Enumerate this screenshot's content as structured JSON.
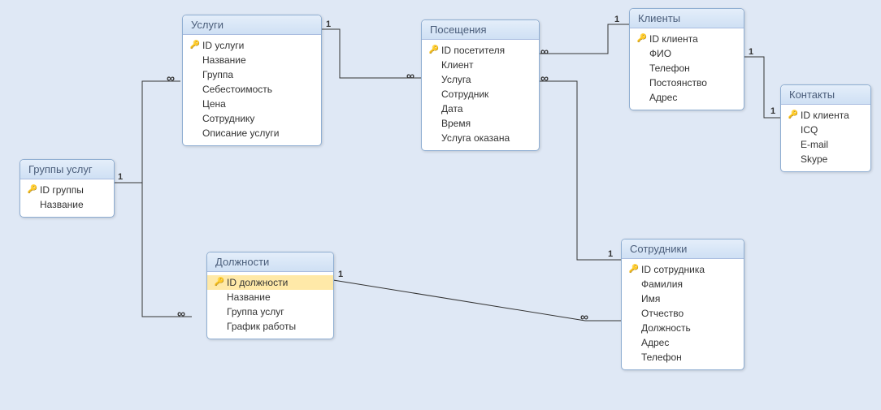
{
  "entities": {
    "groups": {
      "title": "Группы услуг",
      "fields": [
        {
          "label": "ID группы",
          "pk": true
        },
        {
          "label": "Название",
          "pk": false
        }
      ]
    },
    "services": {
      "title": "Услуги",
      "fields": [
        {
          "label": "ID услуги",
          "pk": true
        },
        {
          "label": "Название",
          "pk": false
        },
        {
          "label": "Группа",
          "pk": false
        },
        {
          "label": "Себестоимость",
          "pk": false
        },
        {
          "label": "Цена",
          "pk": false
        },
        {
          "label": "Сотруднику",
          "pk": false
        },
        {
          "label": "Описание услуги",
          "pk": false
        }
      ]
    },
    "visits": {
      "title": "Посещения",
      "fields": [
        {
          "label": "ID посетителя",
          "pk": true
        },
        {
          "label": "Клиент",
          "pk": false
        },
        {
          "label": "Услуга",
          "pk": false
        },
        {
          "label": "Сотрудник",
          "pk": false
        },
        {
          "label": "Дата",
          "pk": false
        },
        {
          "label": "Время",
          "pk": false
        },
        {
          "label": "Услуга оказана",
          "pk": false
        }
      ]
    },
    "clients": {
      "title": "Клиенты",
      "fields": [
        {
          "label": "ID клиента",
          "pk": true
        },
        {
          "label": "ФИО",
          "pk": false
        },
        {
          "label": "Телефон",
          "pk": false
        },
        {
          "label": "Постоянство",
          "pk": false
        },
        {
          "label": "Адрес",
          "pk": false
        }
      ]
    },
    "contacts": {
      "title": "Контакты",
      "fields": [
        {
          "label": "ID клиента",
          "pk": true
        },
        {
          "label": "ICQ",
          "pk": false
        },
        {
          "label": "E-mail",
          "pk": false
        },
        {
          "label": "Skype",
          "pk": false
        }
      ]
    },
    "positions": {
      "title": "Должности",
      "fields": [
        {
          "label": "ID должности",
          "pk": true,
          "selected": true
        },
        {
          "label": "Название",
          "pk": false
        },
        {
          "label": "Группа услуг",
          "pk": false
        },
        {
          "label": "График работы",
          "pk": false
        }
      ]
    },
    "employees": {
      "title": "Сотрудники",
      "fields": [
        {
          "label": "ID сотрудника",
          "pk": true
        },
        {
          "label": "Фамилия",
          "pk": false
        },
        {
          "label": "Имя",
          "pk": false
        },
        {
          "label": "Отчество",
          "pk": false
        },
        {
          "label": "Должность",
          "pk": false
        },
        {
          "label": "Адрес",
          "pk": false
        },
        {
          "label": "Телефон",
          "pk": false
        }
      ]
    }
  },
  "relations": [
    {
      "from": "groups",
      "to": "services",
      "from_card": "1",
      "to_card": "∞"
    },
    {
      "from": "groups",
      "to": "positions",
      "from_card": "1",
      "to_card": "∞"
    },
    {
      "from": "services",
      "to": "visits",
      "from_card": "1",
      "to_card": "∞"
    },
    {
      "from": "clients",
      "to": "visits",
      "from_card": "1",
      "to_card": "∞"
    },
    {
      "from": "clients",
      "to": "contacts",
      "from_card": "1",
      "to_card": "1"
    },
    {
      "from": "positions",
      "to": "employees",
      "from_card": "1",
      "to_card": "∞"
    },
    {
      "from": "employees",
      "to": "visits",
      "from_card": "1",
      "to_card": "∞"
    }
  ],
  "cardinality_labels": {
    "one": "1",
    "many": "∞"
  }
}
